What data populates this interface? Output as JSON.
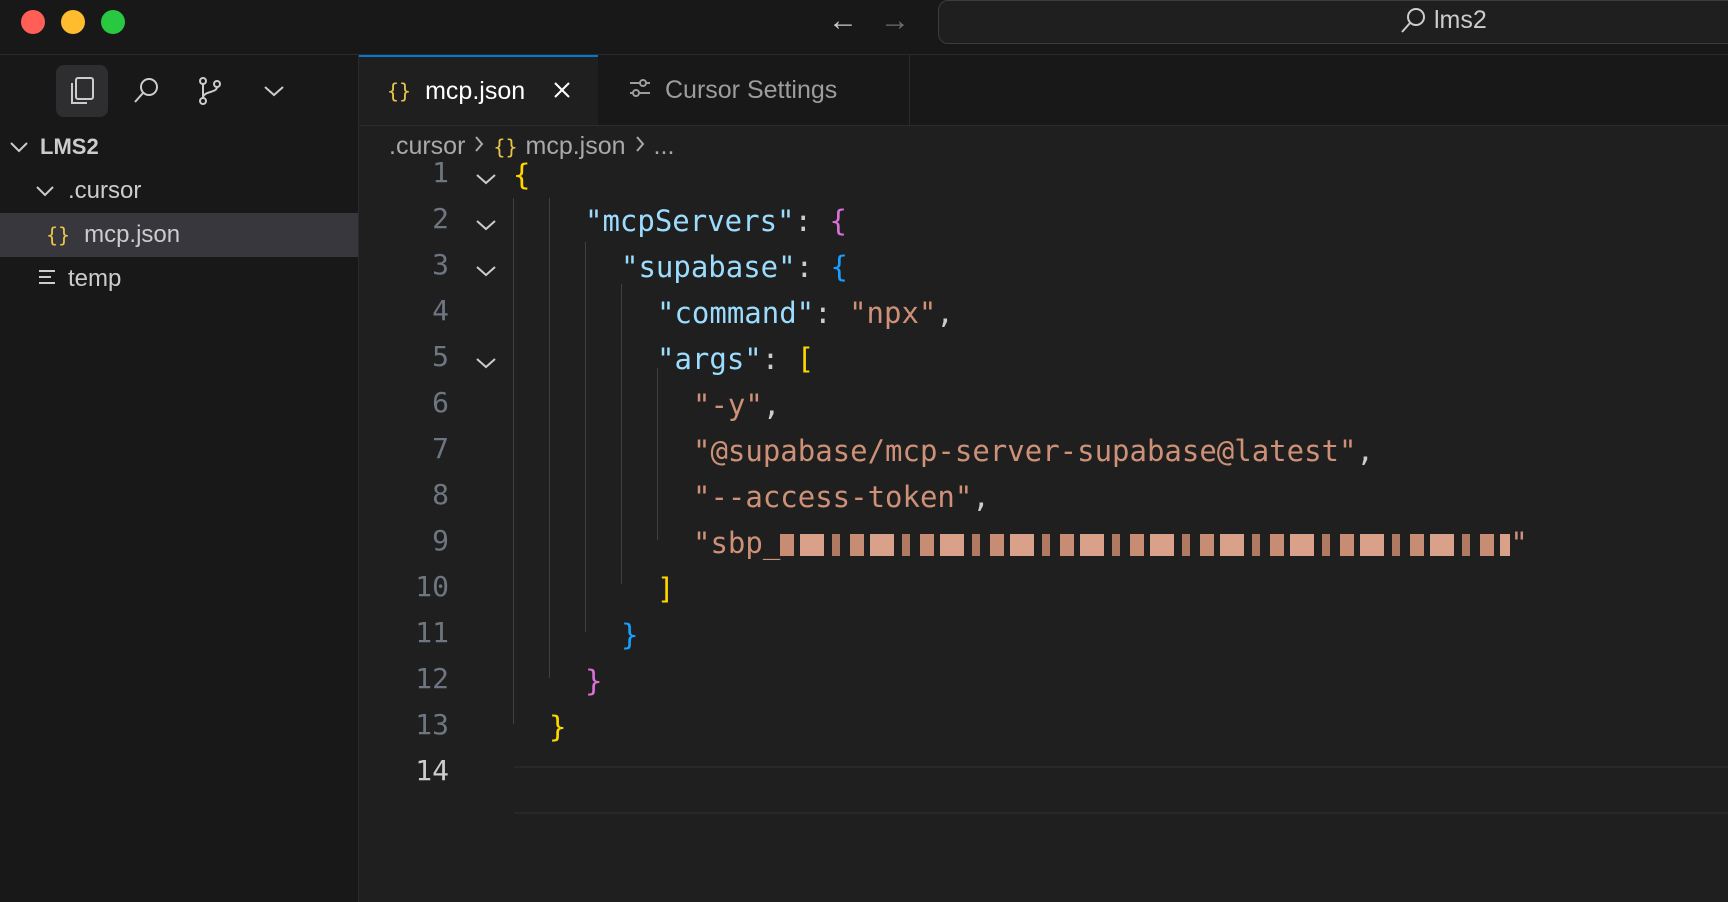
{
  "window": {
    "search_text": "lms2"
  },
  "sidebar": {
    "root_folder": "LMS2",
    "folder": ".cursor",
    "file_selected": "mcp.json",
    "file_other": "temp"
  },
  "tabs": [
    {
      "label": "mcp.json",
      "icon": "braces-icon",
      "active": true
    },
    {
      "label": "Cursor Settings",
      "icon": "settings-sliders-icon",
      "active": false
    }
  ],
  "breadcrumb": {
    "segment1": ".cursor",
    "segment2": "mcp.json",
    "segment3": "..."
  },
  "editor": {
    "line_numbers": [
      "1",
      "2",
      "3",
      "4",
      "5",
      "6",
      "7",
      "8",
      "9",
      "10",
      "11",
      "12",
      "13",
      "14"
    ],
    "current_line": "14",
    "code": {
      "l1_open": "{",
      "l2_key": "\"mcpServers\"",
      "l2_colon": ": ",
      "l2_open": "{",
      "l3_key": "\"supabase\"",
      "l3_colon": ": ",
      "l3_open": "{",
      "l4_key": "\"command\"",
      "l4_colon": ": ",
      "l4_val": "\"npx\"",
      "l4_comma": ",",
      "l5_key": "\"args\"",
      "l5_colon": ": ",
      "l5_open": "[",
      "l6_val": "\"-y\"",
      "l6_comma": ",",
      "l7_val": "\"@supabase/mcp-server-supabase@latest\"",
      "l7_comma": ",",
      "l8_val": "\"--access-token\"",
      "l8_comma": ",",
      "l9_prefix": "\"sbp_",
      "l9_suffix": "\"",
      "l10_close": "]",
      "l11_close": "}",
      "l12_close": "}",
      "l13_close": "}"
    }
  },
  "colors": {
    "keyword": "#9cdcfe",
    "string": "#ce9178",
    "bracket_level1": "#ffd700",
    "bracket_level2": "#da70d6",
    "bracket_level3": "#179fff",
    "tab_accent": "#0078d4"
  }
}
